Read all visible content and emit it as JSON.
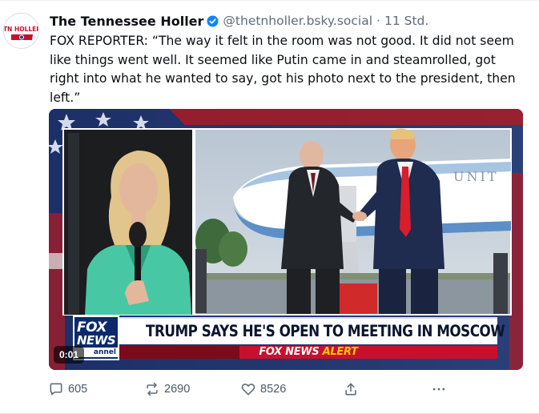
{
  "author": {
    "display_name": "The Tennessee Holler",
    "handle": "@thetnholler.bsky.social",
    "separator": "·",
    "time": "11 Std.",
    "avatar_text": "TN HOLLER"
  },
  "post": {
    "text": "FOX REPORTER: “The way it felt in the room was not good. It did not seem like things went well. It seemed like Putin came in and steamrolled, got right into what he wanted to say, got his photo next to the president, then left.”"
  },
  "video": {
    "timestamp": "0:01",
    "chyron_headline": "TRUMP SAYS HE'S OPEN TO MEETING IN MOSCOW",
    "alert_brand": "FOX NEWS",
    "alert_word": "ALERT",
    "logo_top": "FOX",
    "logo_bottom": "NEWS",
    "logo_channel": "annel",
    "plane_text": "UNIT"
  },
  "actions": {
    "replies": "605",
    "reposts": "2690",
    "likes": "8526"
  },
  "colors": {
    "accent_blue": "#1185fe",
    "text_muted": "#5f6c79",
    "fox_red": "#c8102e",
    "fox_navy": "#0c2a6b"
  },
  "icons": {
    "verified": "verified-check-icon",
    "reply": "reply-bubble-icon",
    "repost": "repost-arrows-icon",
    "like": "heart-icon",
    "share": "share-up-arrow-icon",
    "more": "more-ellipsis-icon"
  }
}
